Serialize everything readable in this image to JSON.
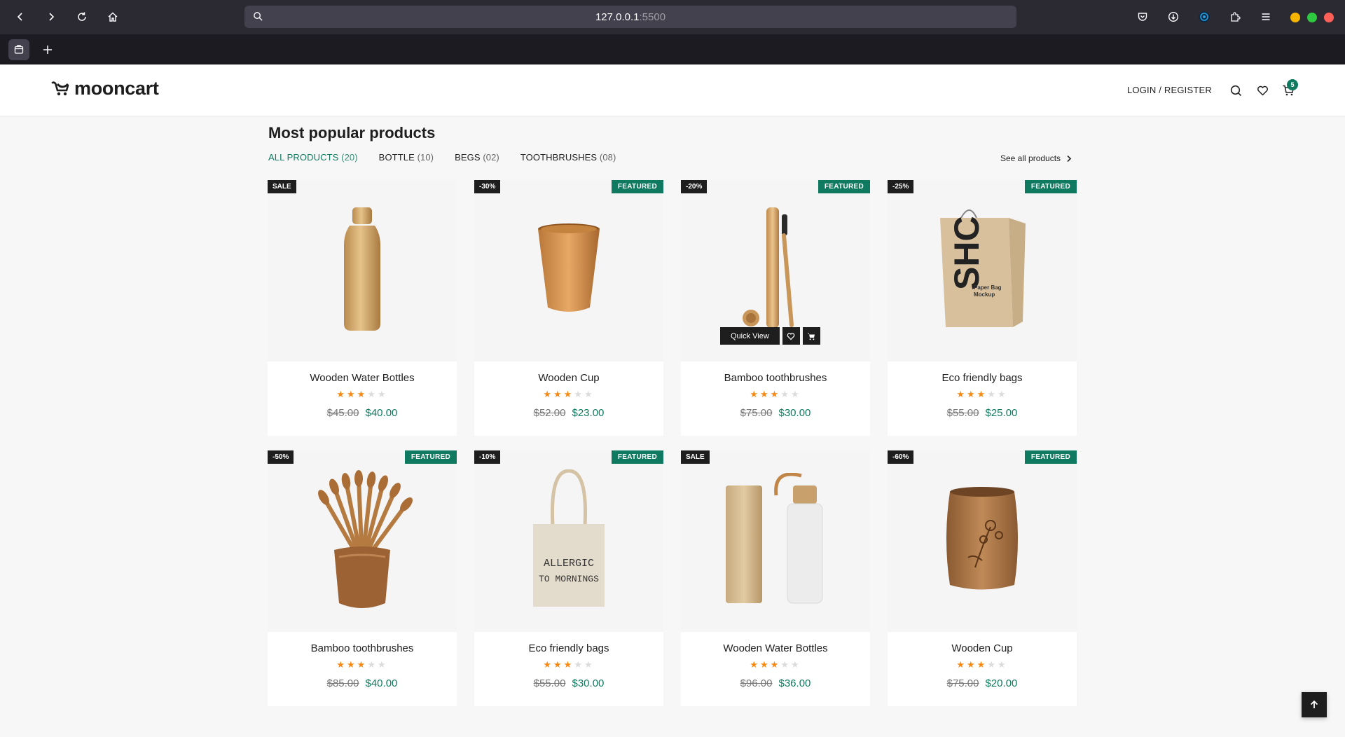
{
  "browser": {
    "url_host": "127.0.0.1",
    "url_port": ":5500",
    "window_colors": {
      "minimize": "#f5b400",
      "maximize": "#2ec940",
      "close": "#ff5f57"
    }
  },
  "site": {
    "logo_text": "mooncart",
    "login_label": "LOGIN / REGISTER",
    "cart_count": "5",
    "accent_color": "#0f7a5f"
  },
  "section": {
    "title": "Most popular products",
    "see_all": "See all products",
    "filters": [
      {
        "label": "ALL PRODUCTS",
        "count": "(20)",
        "active": true
      },
      {
        "label": "BOTTLE",
        "count": "(10)",
        "active": false
      },
      {
        "label": "BEGS",
        "count": "(02)",
        "active": false
      },
      {
        "label": "TOOTHBRUSHES",
        "count": "(08)",
        "active": false
      }
    ]
  },
  "quick_view": {
    "label": "Quick View"
  },
  "products": [
    {
      "name": "Wooden Water Bottles",
      "badge_left": "SALE",
      "badge_right": "",
      "rating": 3,
      "old_price": "$45.00",
      "new_price": "$40.00",
      "image": "bottle"
    },
    {
      "name": "Wooden Cup",
      "badge_left": "-30%",
      "badge_right": "FEATURED",
      "rating": 3,
      "old_price": "$52.00",
      "new_price": "$23.00",
      "image": "cup"
    },
    {
      "name": "Bamboo toothbrushes",
      "badge_left": "-20%",
      "badge_right": "FEATURED",
      "rating": 3,
      "old_price": "$75.00",
      "new_price": "$30.00",
      "image": "brush-tube",
      "hover": true
    },
    {
      "name": "Eco friendly bags",
      "badge_left": "-25%",
      "badge_right": "FEATURED",
      "rating": 3,
      "old_price": "$55.00",
      "new_price": "$25.00",
      "image": "paper-bag"
    },
    {
      "name": "Bamboo toothbrushes",
      "badge_left": "-50%",
      "badge_right": "FEATURED",
      "rating": 3,
      "old_price": "$85.00",
      "new_price": "$40.00",
      "image": "brush-cup"
    },
    {
      "name": "Eco friendly bags",
      "badge_left": "-10%",
      "badge_right": "FEATURED",
      "rating": 3,
      "old_price": "$55.00",
      "new_price": "$30.00",
      "image": "tote",
      "tote_text": [
        "ALLERGIC",
        "TO MORNINGS"
      ]
    },
    {
      "name": "Wooden Water Bottles",
      "badge_left": "SALE",
      "badge_right": "",
      "rating": 3,
      "old_price": "$96.00",
      "new_price": "$36.00",
      "image": "glass-bottle"
    },
    {
      "name": "Wooden Cup",
      "badge_left": "-60%",
      "badge_right": "FEATURED",
      "rating": 3,
      "old_price": "$75.00",
      "new_price": "$20.00",
      "image": "carved-cup"
    }
  ]
}
